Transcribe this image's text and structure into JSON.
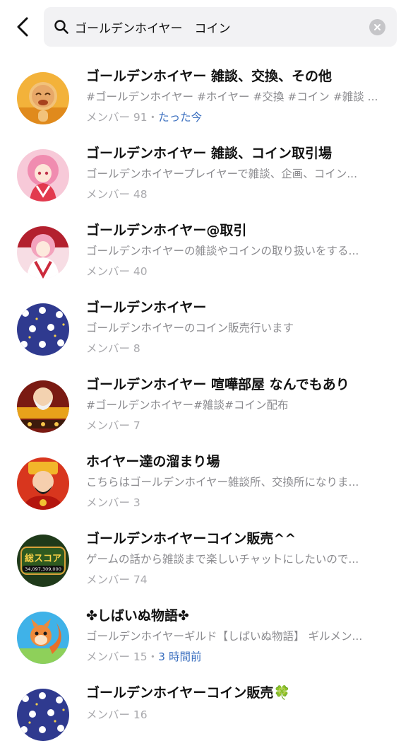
{
  "search": {
    "query": "ゴールデンホイヤー　コイン"
  },
  "results": [
    {
      "title": "ゴールデンホイヤー 雑談、交換、その他",
      "description": "#ゴールデンホイヤー #ホイヤー #交換 #コイン #雑談 ...",
      "members_label": "メンバー 91",
      "separator": "・",
      "time": "たった今",
      "avatar": "golden-buddha-avatar"
    },
    {
      "title": "ゴールデンホイヤー 雑談、コイン取引場",
      "description": "ゴールデンホイヤープレイヤーで雑談、企画、コイン...",
      "members_label": "メンバー 48",
      "avatar": "pink-hair-girl-avatar"
    },
    {
      "title": "ゴールデンホイヤー@取引",
      "description": "ゴールデンホイヤーの雑談やコインの取り扱いをする...",
      "members_label": "メンバー 40",
      "avatar": "kimono-girl-avatar"
    },
    {
      "title": "ゴールデンホイヤー",
      "description": "ゴールデンホイヤーのコイン販売行います",
      "members_label": "メンバー 8",
      "avatar": "bunny-pattern-avatar"
    },
    {
      "title": "ゴールデンホイヤー 喧嘩部屋 なんでもあり",
      "description": "#ゴールデンホイヤー#雑談#コイン配布",
      "members_label": "メンバー 7",
      "avatar": "slot-god-avatar"
    },
    {
      "title": "ホイヤー達の溜まり場",
      "description": "こちらはゴールデンホイヤー雑談所、交換所になりま...",
      "members_label": "メンバー 3",
      "avatar": "fortune-god-avatar"
    },
    {
      "title": "ゴールデンホイヤーコイン販売^^",
      "description": "ゲームの話から雑談まで楽しいチャットにしたいので...",
      "members_label": "メンバー 74",
      "avatar": "score-badge-avatar",
      "avatar_text_top": "総スコア",
      "avatar_text_bottom": "34,097,309,000"
    },
    {
      "title": "✤しばいぬ物語✤",
      "description": "ゴールデンホイヤーギルド【しばいぬ物語】 ギルメン...",
      "members_label": "メンバー 15",
      "separator": "・",
      "time": "3 時間前",
      "avatar": "squirrel-avatar"
    },
    {
      "title": "ゴールデンホイヤーコイン販売",
      "title_suffix": "🍀",
      "description": "",
      "members_label": "メンバー 16",
      "avatar": "bunny-pattern-avatar"
    }
  ],
  "colors": {
    "title": "#111111",
    "description": "#8a8a8e",
    "meta": "#a9a9ad",
    "time_accent": "#3b6fbf",
    "search_bg": "#f2f2f4"
  }
}
